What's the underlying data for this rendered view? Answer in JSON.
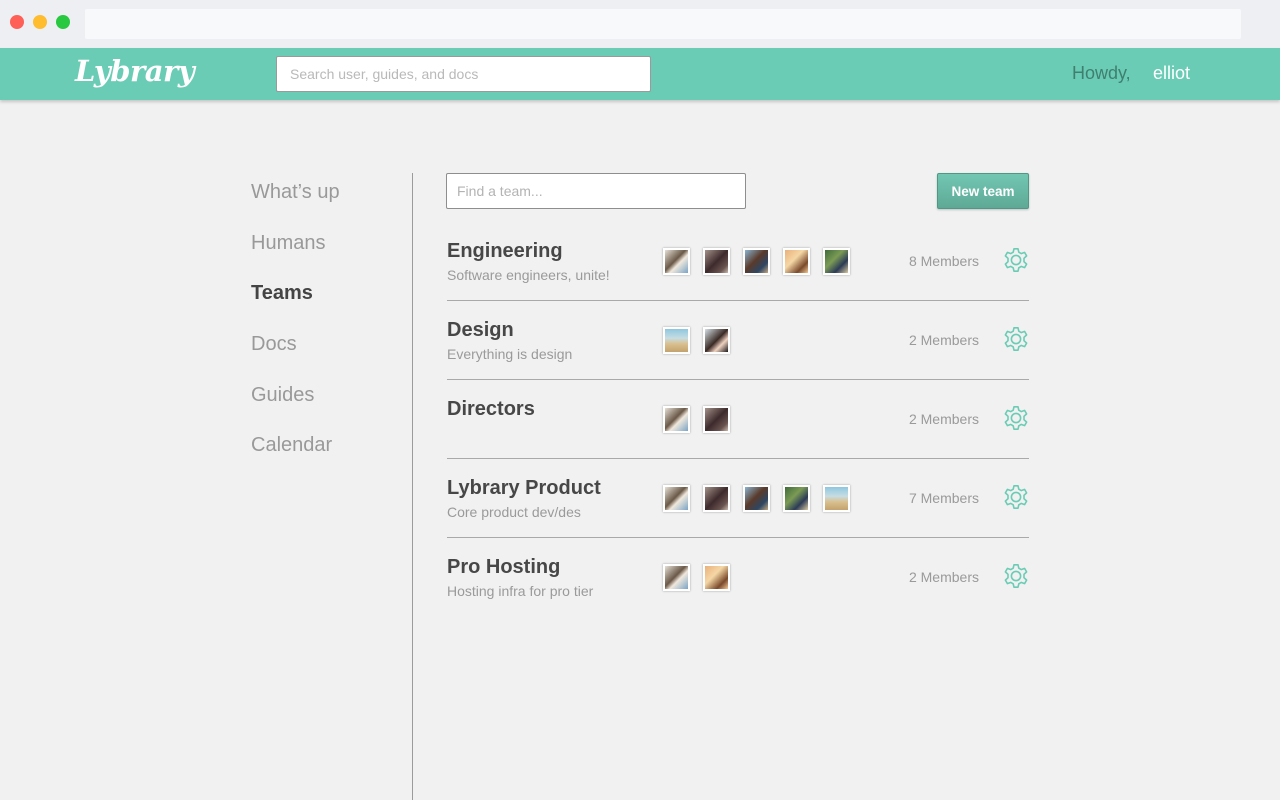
{
  "app": {
    "logo": "Lybrary",
    "search_placeholder": "Search user, guides, and docs",
    "greeting": "Howdy,",
    "username": "elliot"
  },
  "sidebar": {
    "items": [
      {
        "label": "What’s up",
        "active": false
      },
      {
        "label": "Humans",
        "active": false
      },
      {
        "label": "Teams",
        "active": true
      },
      {
        "label": "Docs",
        "active": false
      },
      {
        "label": "Guides",
        "active": false
      },
      {
        "label": "Calendar",
        "active": false
      }
    ]
  },
  "main": {
    "find_placeholder": "Find a team...",
    "new_team_label": "New team",
    "teams": [
      {
        "name": "Engineering",
        "description": "Software engineers, unite!",
        "members_label": "8 Members",
        "avatars": [
          "av-1",
          "av-2",
          "av-3",
          "av-4",
          "av-5"
        ]
      },
      {
        "name": "Design",
        "description": "Everything is design",
        "members_label": "2 Members",
        "avatars": [
          "av-6",
          "av-7"
        ]
      },
      {
        "name": "Directors",
        "description": "",
        "members_label": "2 Members",
        "avatars": [
          "av-1",
          "av-2"
        ]
      },
      {
        "name": "Lybrary Product",
        "description": "Core product dev/des",
        "members_label": "7 Members",
        "avatars": [
          "av-1",
          "av-2",
          "av-3",
          "av-5",
          "av-6"
        ]
      },
      {
        "name": "Pro Hosting",
        "description": "Hosting infra for pro tier",
        "members_label": "2 Members",
        "avatars": [
          "av-1",
          "av-4"
        ]
      }
    ]
  },
  "colors": {
    "brand": "#6bccb5",
    "accent_button": "#66b6a3",
    "gear": "#6bccb5"
  },
  "icons": {
    "settings": "gear-icon"
  }
}
